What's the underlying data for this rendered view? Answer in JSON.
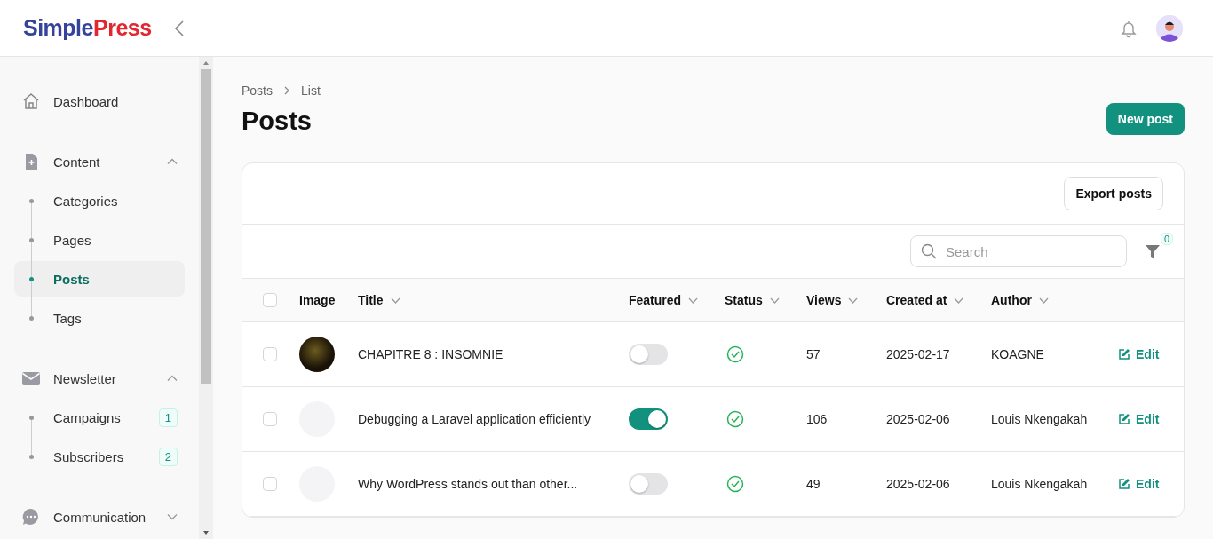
{
  "header": {
    "logo": {
      "text_1": "Simple",
      "text_2": "Press"
    }
  },
  "sidebar": {
    "items": [
      {
        "kind": "link",
        "label": "Dashboard"
      },
      {
        "kind": "group",
        "label": "Content",
        "expanded": true,
        "children": [
          {
            "label": "Categories",
            "selected": false
          },
          {
            "label": "Pages",
            "selected": false
          },
          {
            "label": "Posts",
            "selected": true
          },
          {
            "label": "Tags",
            "selected": false
          }
        ]
      },
      {
        "kind": "group",
        "label": "Newsletter",
        "expanded": true,
        "children": [
          {
            "label": "Campaigns",
            "selected": false,
            "badge": "1"
          },
          {
            "label": "Subscribers",
            "selected": false,
            "badge": "2"
          }
        ]
      },
      {
        "kind": "group",
        "label": "Communication",
        "expanded": false
      }
    ]
  },
  "breadcrumb": [
    "Posts",
    "List"
  ],
  "page_title": "Posts",
  "new_button": "New post",
  "export_button": "Export posts",
  "search": {
    "placeholder": "Search"
  },
  "filter_count": "0",
  "table": {
    "all_checked": false,
    "columns": [
      {
        "label": "Image",
        "sortable": false
      },
      {
        "label": "Title",
        "sortable": true
      },
      {
        "label": "Featured",
        "sortable": true
      },
      {
        "label": "Status",
        "sortable": true
      },
      {
        "label": "Views",
        "sortable": true
      },
      {
        "label": "Created at",
        "sortable": true
      },
      {
        "label": "Author",
        "sortable": true
      }
    ],
    "rows": [
      {
        "checked": false,
        "title": "CHAPITRE 8 : INSOMNIE",
        "featured": false,
        "views": "57",
        "created": "2025-02-17",
        "author": "KOAGNE",
        "action": "Edit"
      },
      {
        "checked": false,
        "title": "Debugging a Laravel application efficiently",
        "featured": true,
        "views": "106",
        "created": "2025-02-06",
        "author": "Louis Nkengakah",
        "action": "Edit"
      },
      {
        "checked": false,
        "title": "Why WordPress stands out than other...",
        "featured": false,
        "views": "49",
        "created": "2025-02-06",
        "author": "Louis Nkengakah",
        "action": "Edit"
      }
    ]
  }
}
